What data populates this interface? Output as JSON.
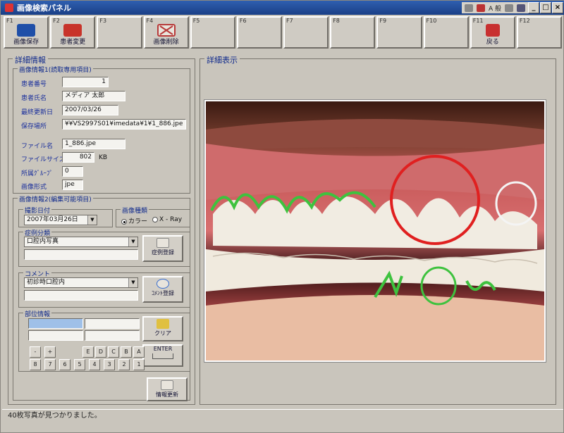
{
  "window": {
    "title": "画像検索パネル",
    "min": "_",
    "max": "□",
    "close": "×"
  },
  "tray": {
    "lang": "A 般"
  },
  "fkeys": [
    {
      "key": "F1",
      "label": "画像保存",
      "icon": "save-image-icon",
      "color": "#1f4fa8"
    },
    {
      "key": "F2",
      "label": "患者変更",
      "icon": "change-patient-icon",
      "color": "#c8332a"
    },
    {
      "key": "F3",
      "label": "",
      "icon": "",
      "color": ""
    },
    {
      "key": "F4",
      "label": "画像削除",
      "icon": "delete-image-icon",
      "color": "#b83a3a"
    },
    {
      "key": "F5",
      "label": "",
      "icon": "",
      "color": ""
    },
    {
      "key": "F6",
      "label": "",
      "icon": "",
      "color": ""
    },
    {
      "key": "F7",
      "label": "",
      "icon": "",
      "color": ""
    },
    {
      "key": "F8",
      "label": "",
      "icon": "",
      "color": ""
    },
    {
      "key": "F9",
      "label": "",
      "icon": "",
      "color": ""
    },
    {
      "key": "F10",
      "label": "",
      "icon": "",
      "color": ""
    },
    {
      "key": "F11",
      "label": "戻る",
      "icon": "back-icon",
      "color": "#c83030"
    },
    {
      "key": "F12",
      "label": "",
      "icon": "",
      "color": ""
    }
  ],
  "detail": {
    "title": "詳細情報",
    "info1_title": "画像情報1(読取専用項目)",
    "patient_no_label": "患者番号",
    "patient_no": "1",
    "patient_name_label": "患者氏名",
    "patient_name": "メディア 太郎",
    "last_updated_label": "最終更新日",
    "last_updated": "2007/03/26",
    "save_location_label": "保存場所",
    "save_location": "¥¥VS2997S01¥imedata¥1¥1_886.jpe",
    "file_name_label": "ファイル名",
    "file_name": "1_886.jpe",
    "file_size_label": "ファイルサイズ",
    "file_size": "802",
    "file_size_unit": "KB",
    "group_label": "所属ｸﾞﾙｰﾌﾟ",
    "group": "0",
    "format_label": "画像形式",
    "format": "jpe",
    "info2_title": "画像情報2(編集可能項目)",
    "shot_date_label": "撮影日付",
    "shot_date": "2007年03月26日",
    "image_type_label": "画像種類",
    "type_color": "カラー",
    "type_xray": "X - Ray",
    "case_label": "症例分類",
    "case_value": "口腔内写真",
    "case_register": "症例登録",
    "comment_label": "コメント",
    "comment_value": "初診時口腔内",
    "comment_register": "ｺﾒﾝﾄ登録",
    "site_label": "部位情報",
    "clear": "クリア",
    "enter": "ENTER",
    "keys_row1": [
      "-",
      "+",
      "E",
      "D",
      "C",
      "B",
      "A"
    ],
    "keys_row2": [
      "8",
      "7",
      "6",
      "5",
      "4",
      "3",
      "2",
      "1"
    ],
    "update": "情報更新"
  },
  "view": {
    "title": "詳細表示"
  },
  "status": {
    "text": "40枚写真が見つかりました。"
  }
}
